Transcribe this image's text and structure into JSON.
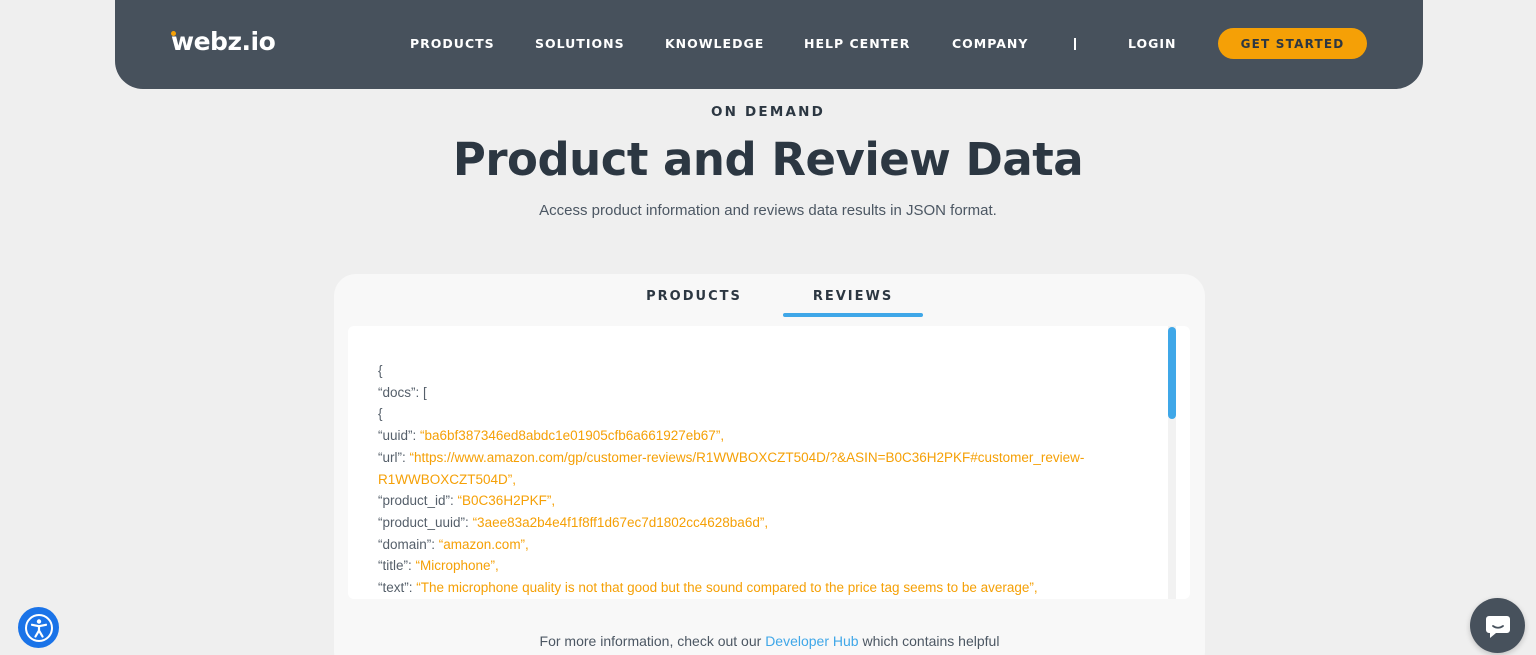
{
  "nav": {
    "logo": "webz.io",
    "items": [
      "PRODUCTS",
      "SOLUTIONS",
      "KNOWLEDGE",
      "HELP CENTER",
      "COMPANY"
    ],
    "separator": "|",
    "login": "LOGIN",
    "cta": "GET STARTED"
  },
  "hero": {
    "eyebrow": "ON DEMAND",
    "title": "Product and Review Data",
    "subtitle": "Access product information and reviews data results in JSON format."
  },
  "tabs": {
    "products": "PRODUCTS",
    "reviews": "REVIEWS",
    "active": "reviews"
  },
  "code": {
    "l1": "{",
    "l2": "“docs”: [",
    "l3": "{",
    "uuid_key": "“uuid”: ",
    "uuid_val": "“ba6bf387346ed8abdc1e01905cfb6a661927eb67”,",
    "url_key": "“url”: ",
    "url_val_1": "“https://www.amazon.com/gp/customer-reviews/R1WWBOXCZT504D/?&ASIN=B0C36H2PKF#customer_review-",
    "url_val_2": "R1WWBOXCZT504D”,",
    "pid_key": "“product_id”: ",
    "pid_val": "“B0C36H2PKF”,",
    "puuid_key": "“product_uuid”: ",
    "puuid_val": "“3aee83a2b4e4f1f8ff1d67ec7d1802cc4628ba6d”,",
    "domain_key": "“domain”: ",
    "domain_val": "“amazon.com”,",
    "title_key": "“title”: ",
    "title_val": "“Microphone”,",
    "text_key": "“text”: ",
    "text_val": "“The microphone quality is not that good but the sound compared to the price tag seems to be average”,"
  },
  "footnote": {
    "before": "For more information, check out our ",
    "link": "Developer Hub",
    "after": " which contains helpful"
  },
  "colors": {
    "nav_bg": "#47515c",
    "accent_orange": "#f5a006",
    "accent_blue": "#3fa7e8",
    "a11y_blue": "#1a73e8"
  },
  "icons": {
    "accessibility": "accessibility-icon",
    "chat": "chat-icon"
  }
}
